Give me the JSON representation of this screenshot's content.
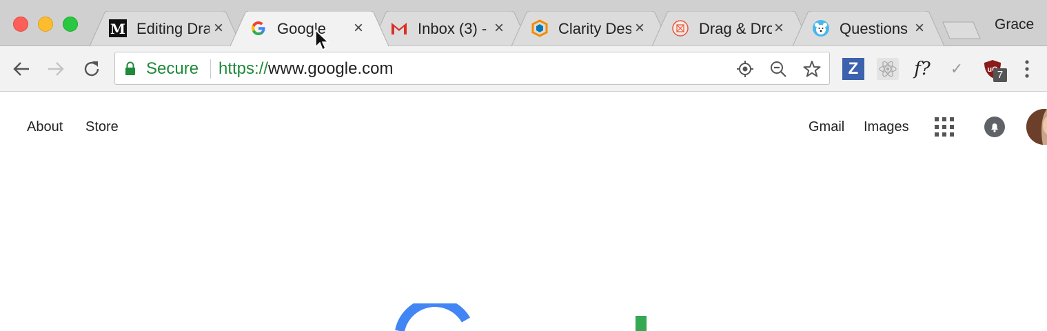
{
  "window": {
    "profile_name": "Grace"
  },
  "tabs": [
    {
      "title": "Editing Dra",
      "favicon": "medium-icon",
      "active": false
    },
    {
      "title": "Google",
      "favicon": "google-g-icon",
      "active": true
    },
    {
      "title": "Inbox (3) -",
      "favicon": "gmail-icon",
      "active": false
    },
    {
      "title": "Clarity Des",
      "favicon": "clarity-icon",
      "active": false
    },
    {
      "title": "Drag & Dro",
      "favicon": "drag-drop-icon",
      "active": false
    },
    {
      "title": "Questions",
      "favicon": "polar-bear-icon",
      "active": false
    }
  ],
  "toolbar": {
    "secure_label": "Secure",
    "url_scheme": "https://",
    "url_host": "www.google.com",
    "extensions": [
      {
        "label": "Z",
        "icon": "zenhub-icon"
      },
      {
        "label": "",
        "icon": "react-icon"
      },
      {
        "label": "f?",
        "icon": "whatfont-icon"
      },
      {
        "label": "✓",
        "icon": "check-icon"
      },
      {
        "label": "",
        "icon": "ublock-icon"
      }
    ],
    "ublock_badge": "7"
  },
  "page": {
    "left_links": [
      "About",
      "Store"
    ],
    "right_links": [
      "Gmail",
      "Images"
    ]
  },
  "colors": {
    "secure_green": "#1e8a3a",
    "tab_strip": "#d0d0d0",
    "toolbar": "#f2f2f2",
    "google_blue": "#4285f4",
    "google_green": "#34a853"
  }
}
